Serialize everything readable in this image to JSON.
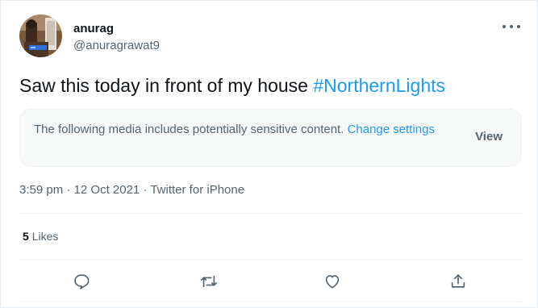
{
  "user": {
    "display_name": "anurag",
    "handle": "@anuragrawat9"
  },
  "tweet": {
    "text": "Saw this today in front of my house ",
    "hashtag": "#NorthernLights"
  },
  "sensitive_notice": {
    "text": "The following media includes potentially sensitive content. ",
    "link_label": "Change settings",
    "view_label": "View"
  },
  "meta": {
    "time": "3:59 pm",
    "date": "12 Oct 2021",
    "source": "Twitter for iPhone"
  },
  "stats": {
    "likes_count": "5",
    "likes_label": "Likes"
  },
  "actions": {
    "icons": [
      "reply-icon",
      "retweet-icon",
      "like-icon",
      "share-icon"
    ]
  },
  "colors": {
    "accent": "#1d9bf0",
    "text_secondary": "#536471",
    "text_primary": "#0f1419"
  }
}
